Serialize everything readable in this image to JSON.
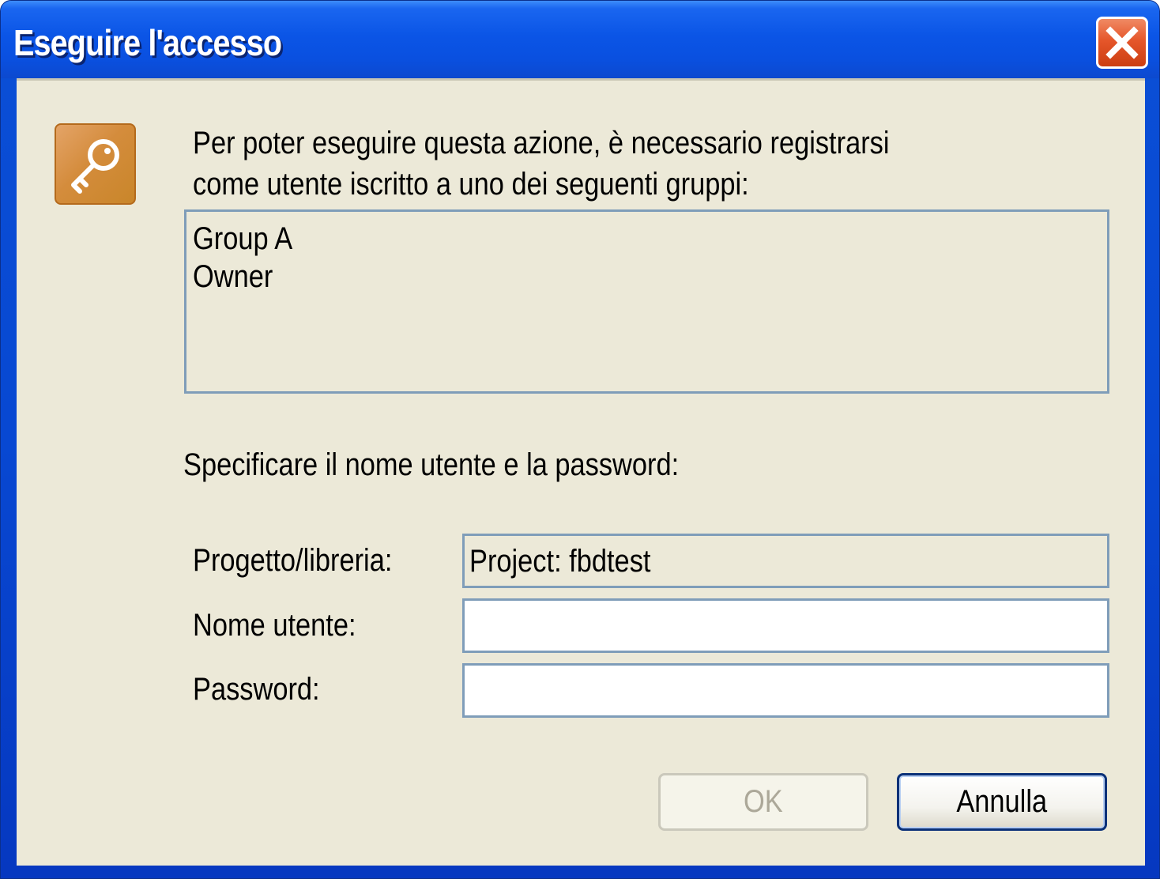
{
  "window": {
    "title": "Eseguire l'accesso",
    "close_icon": "close-icon"
  },
  "dialog": {
    "icon": "key-icon",
    "message_line1": "Per poter eseguire questa azione, è necessario registrarsi",
    "message_line2": "come utente iscritto a uno dei seguenti gruppi:",
    "groups": [
      "Group A",
      "Owner"
    ],
    "prompt": "Specificare il nome utente e la password:",
    "project_label": "Progetto/libreria:",
    "project_value": "Project: fbdtest",
    "username_label": "Nome utente:",
    "username_value": "",
    "password_label": "Password:",
    "password_value": ""
  },
  "buttons": {
    "ok_label": "OK",
    "cancel_label": "Annulla"
  },
  "colors": {
    "titlebar": "#0a50e0",
    "client_bg": "#ece9d8",
    "field_border": "#7f9db9",
    "close_button": "#e5562a",
    "icon_bg": "#d48c3c"
  }
}
